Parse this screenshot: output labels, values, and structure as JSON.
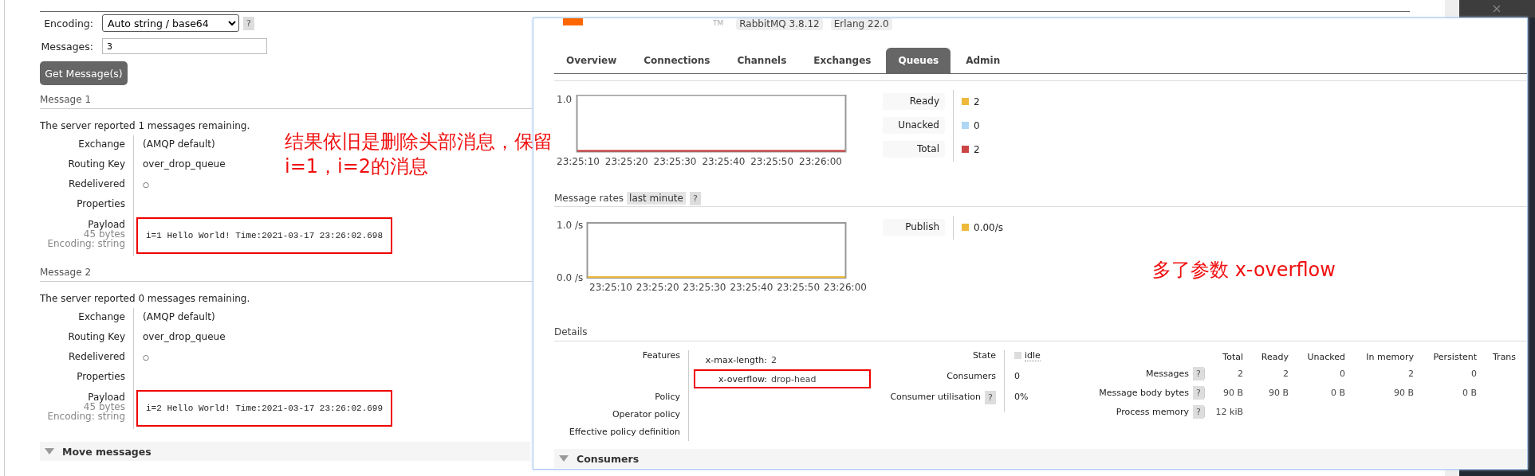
{
  "page": {
    "encoding": {
      "label": "Encoding:",
      "value": "Auto string / base64",
      "help": "?"
    },
    "messages_field": {
      "label": "Messages:",
      "value": "3"
    },
    "get_button": "Get Message(s)",
    "messages": [
      {
        "title": "Message 1",
        "remaining": "The server reported 1 messages remaining.",
        "fields": [
          {
            "label": "Exchange",
            "value": "(AMQP default)"
          },
          {
            "label": "Routing Key",
            "value": "over_drop_queue"
          },
          {
            "label": "Redelivered",
            "value": "○"
          },
          {
            "label": "Properties"
          }
        ],
        "payload": {
          "label": "Payload",
          "size": "45 bytes",
          "encoding": "Encoding: string",
          "value": "i=1 Hello World! Time:2021-03-17 23:26:02.698",
          "highlighted": true
        }
      },
      {
        "title": "Message 2",
        "remaining": "The server reported 0 messages remaining.",
        "fields": [
          {
            "label": "Exchange",
            "value": "(AMQP default)"
          },
          {
            "label": "Routing Key",
            "value": "over_drop_queue"
          },
          {
            "label": "Redelivered",
            "value": "○"
          },
          {
            "label": "Properties"
          }
        ],
        "payload": {
          "label": "Payload",
          "size": "45 bytes",
          "encoding": "Encoding: string",
          "value": "i=2 Hello World! Time:2021-03-17 23:26:02.699",
          "highlighted": true
        }
      }
    ],
    "move_messages": {
      "label": "Move messages"
    }
  },
  "annotations": [
    {
      "lines": [
        "结果依旧是删除头部消息，保留",
        "i=1，i=2的消息"
      ]
    },
    {
      "lines": [
        "多了参数 x-overflow"
      ]
    }
  ],
  "window": {
    "trademark": "TM",
    "version": "RabbitMQ 3.8.12",
    "erlang": "Erlang 22.0",
    "tabs": [
      {
        "label": "Overview",
        "selected": false
      },
      {
        "label": "Connections",
        "selected": false
      },
      {
        "label": "Channels",
        "selected": false
      },
      {
        "label": "Exchanges",
        "selected": false
      },
      {
        "label": "Queues",
        "selected": true
      },
      {
        "label": "Admin",
        "selected": false
      }
    ],
    "queued": {
      "y_label": "1.0",
      "time_labels": [
        "23:25:10",
        "23:25:20",
        "23:25:30",
        "23:25:40",
        "23:25:50",
        "23:26:00"
      ],
      "legend": [
        {
          "label": "Ready",
          "color": "#edb93a",
          "value": "2"
        },
        {
          "label": "Unacked",
          "color": "#aed6f5",
          "value": "0"
        },
        {
          "label": "Total",
          "color": "#cc4444",
          "value": "2"
        }
      ]
    },
    "rates": {
      "title": "Message rates",
      "range": "last minute",
      "help": "?",
      "y_labels": [
        "1.0 /s",
        "0.0 /s"
      ],
      "time_labels": [
        "23:25:10",
        "23:25:20",
        "23:25:30",
        "23:25:40",
        "23:25:50",
        "23:26:00"
      ],
      "legend": [
        {
          "label": "Publish",
          "color": "#edb93a",
          "value": "0.00/s"
        }
      ]
    },
    "details": {
      "title": "Details",
      "features_label": "Features",
      "features": [
        {
          "key": "x-max-length:",
          "value": "2",
          "highlighted": false
        },
        {
          "key": "x-overflow:",
          "value": "drop-head",
          "highlighted": true
        }
      ],
      "policies": [
        "Policy",
        "Operator policy",
        "Effective policy definition"
      ],
      "state": [
        {
          "label": "State",
          "value": "idle",
          "kind": "state"
        },
        {
          "label": "Consumers",
          "value": "0",
          "kind": "plain"
        },
        {
          "label": "Consumer utilisation",
          "help": "?",
          "value": "0%",
          "kind": "plain"
        }
      ],
      "columns": [
        "Total",
        "Ready",
        "Unacked",
        "In memory",
        "Persistent",
        "Trans"
      ],
      "rows": [
        {
          "label": "Messages",
          "help": "?",
          "cells": [
            "2",
            "2",
            "0",
            "2",
            "0"
          ]
        },
        {
          "label": "Message body bytes",
          "help": "?",
          "cells": [
            "90 B",
            "90 B",
            "0 B",
            "90 B",
            "0 B"
          ]
        },
        {
          "label": "Process memory",
          "help": "?",
          "cells": [
            "12 kiB"
          ]
        }
      ]
    },
    "consumers": {
      "label": "Consumers"
    }
  }
}
